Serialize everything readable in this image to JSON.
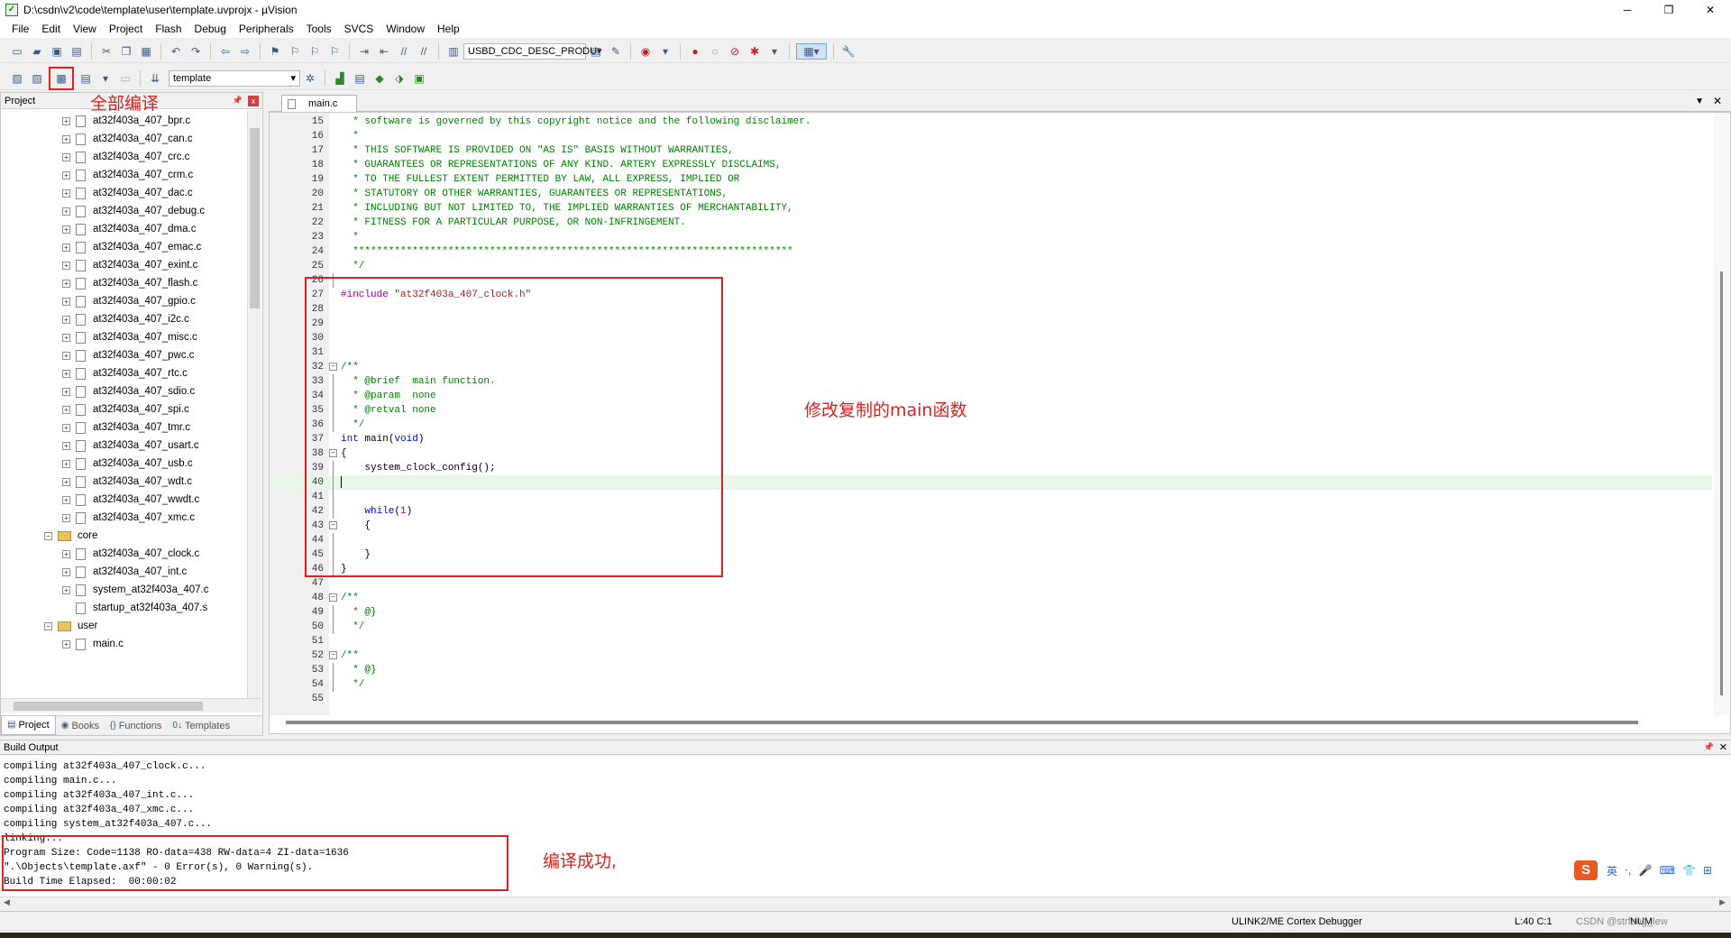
{
  "window": {
    "title": "D:\\csdn\\v2\\code\\template\\user\\template.uvprojx - µVision",
    "minimize": "─",
    "maximize": "❐",
    "close": "✕"
  },
  "menu": [
    "File",
    "Edit",
    "View",
    "Project",
    "Flash",
    "Debug",
    "Peripherals",
    "Tools",
    "SVCS",
    "Window",
    "Help"
  ],
  "toolbar": {
    "config_combo": "USBD_CDC_DESC_PRODU",
    "target_combo": "template"
  },
  "project_panel": {
    "title": "Project",
    "pin": "📌",
    "close": "x",
    "annotation": "全部编译",
    "files_top": [
      "at32f403a_407_bpr.c",
      "at32f403a_407_can.c",
      "at32f403a_407_crc.c",
      "at32f403a_407_crm.c",
      "at32f403a_407_dac.c",
      "at32f403a_407_debug.c",
      "at32f403a_407_dma.c",
      "at32f403a_407_emac.c",
      "at32f403a_407_exint.c",
      "at32f403a_407_flash.c",
      "at32f403a_407_gpio.c",
      "at32f403a_407_i2c.c",
      "at32f403a_407_misc.c",
      "at32f403a_407_pwc.c",
      "at32f403a_407_rtc.c",
      "at32f403a_407_sdio.c",
      "at32f403a_407_spi.c",
      "at32f403a_407_tmr.c",
      "at32f403a_407_usart.c",
      "at32f403a_407_usb.c",
      "at32f403a_407_wdt.c",
      "at32f403a_407_wwdt.c",
      "at32f403a_407_xmc.c"
    ],
    "core_folder": "core",
    "core_files": [
      "at32f403a_407_clock.c",
      "at32f403a_407_int.c",
      "system_at32f403a_407.c",
      "startup_at32f403a_407.s"
    ],
    "user_folder": "user",
    "user_files": [
      "main.c"
    ],
    "tabs": [
      "Project",
      "Books",
      "Functions",
      "Templates"
    ]
  },
  "editor": {
    "tab": "main.c",
    "annotation": "修改复制的main函数",
    "lines": [
      {
        "n": "15",
        "t": "  * software is governed by this copyright notice and the following disclaimer.",
        "c": "comment"
      },
      {
        "n": "16",
        "t": "  *",
        "c": "comment"
      },
      {
        "n": "17",
        "t": "  * THIS SOFTWARE IS PROVIDED ON \"AS IS\" BASIS WITHOUT WARRANTIES,",
        "c": "comment"
      },
      {
        "n": "18",
        "t": "  * GUARANTEES OR REPRESENTATIONS OF ANY KIND. ARTERY EXPRESSLY DISCLAIMS,",
        "c": "comment"
      },
      {
        "n": "19",
        "t": "  * TO THE FULLEST EXTENT PERMITTED BY LAW, ALL EXPRESS, IMPLIED OR",
        "c": "comment"
      },
      {
        "n": "20",
        "t": "  * STATUTORY OR OTHER WARRANTIES, GUARANTEES OR REPRESENTATIONS,",
        "c": "comment"
      },
      {
        "n": "21",
        "t": "  * INCLUDING BUT NOT LIMITED TO, THE IMPLIED WARRANTIES OF MERCHANTABILITY,",
        "c": "comment"
      },
      {
        "n": "22",
        "t": "  * FITNESS FOR A PARTICULAR PURPOSE, OR NON-INFRINGEMENT.",
        "c": "comment"
      },
      {
        "n": "23",
        "t": "  *",
        "c": "comment"
      },
      {
        "n": "24",
        "t": "  **************************************************************************",
        "c": "comment"
      },
      {
        "n": "25",
        "t": "  */",
        "c": "comment"
      },
      {
        "n": "26",
        "t": "",
        "c": "plain"
      },
      {
        "n": "27",
        "t": "",
        "c": "include"
      },
      {
        "n": "28",
        "t": "",
        "c": "plain"
      },
      {
        "n": "29",
        "t": "",
        "c": "plain"
      },
      {
        "n": "30",
        "t": "",
        "c": "plain"
      },
      {
        "n": "31",
        "t": "",
        "c": "plain"
      },
      {
        "n": "32",
        "t": "/**",
        "c": "comment"
      },
      {
        "n": "33",
        "t": "  * @brief  main function.",
        "c": "comment"
      },
      {
        "n": "34",
        "t": "  * @param  none",
        "c": "comment"
      },
      {
        "n": "35",
        "t": "  * @retval none",
        "c": "comment"
      },
      {
        "n": "36",
        "t": "  */",
        "c": "comment"
      },
      {
        "n": "37",
        "t": "",
        "c": "main"
      },
      {
        "n": "38",
        "t": "{",
        "c": "plain"
      },
      {
        "n": "39",
        "t": "    system_clock_config();",
        "c": "plain"
      },
      {
        "n": "40",
        "t": "",
        "c": "current"
      },
      {
        "n": "41",
        "t": "",
        "c": "plain"
      },
      {
        "n": "42",
        "t": "",
        "c": "while"
      },
      {
        "n": "43",
        "t": "    {",
        "c": "plain"
      },
      {
        "n": "44",
        "t": "",
        "c": "plain"
      },
      {
        "n": "45",
        "t": "    }",
        "c": "plain"
      },
      {
        "n": "46",
        "t": "}",
        "c": "plain"
      },
      {
        "n": "47",
        "t": "",
        "c": "plain"
      },
      {
        "n": "48",
        "t": "/**",
        "c": "comment"
      },
      {
        "n": "49",
        "t": "  * @}",
        "c": "comment"
      },
      {
        "n": "50",
        "t": "  */",
        "c": "comment"
      },
      {
        "n": "51",
        "t": "",
        "c": "plain"
      },
      {
        "n": "52",
        "t": "/**",
        "c": "comment"
      },
      {
        "n": "53",
        "t": "  * @}",
        "c": "comment"
      },
      {
        "n": "54",
        "t": "  */",
        "c": "comment"
      },
      {
        "n": "55",
        "t": "",
        "c": "plain"
      }
    ],
    "include_kw": "#include",
    "include_file": "\"at32f403a_407_clock.h\"",
    "main_kw": "int",
    "main_name": " main(",
    "main_arg": "void",
    "main_close": ")",
    "while_kw": "while",
    "while_open": "(",
    "while_num": "1",
    "while_close": ")"
  },
  "build": {
    "title": "Build Output",
    "lines": [
      "compiling at32f403a_407_clock.c...",
      "compiling main.c...",
      "compiling at32f403a_407_int.c...",
      "compiling at32f403a_407_xmc.c...",
      "compiling system_at32f403a_407.c...",
      "linking...",
      "Program Size: Code=1138 RO-data=438 RW-data=4 ZI-data=1636",
      "\".\\Objects\\template.axf\" - 0 Error(s), 0 Warning(s).",
      "Build Time Elapsed:  00:00:02"
    ],
    "annotation": "编译成功,"
  },
  "status": {
    "debugger": "ULINK2/ME Cortex Debugger",
    "position": "L:40 C:1",
    "caps": "NUM",
    "watermark": "CSDN @strfang_lew"
  },
  "ime": {
    "logo": "S",
    "items": [
      "英",
      "·,",
      "🎤",
      "⌨",
      "👕",
      "⊞"
    ]
  }
}
